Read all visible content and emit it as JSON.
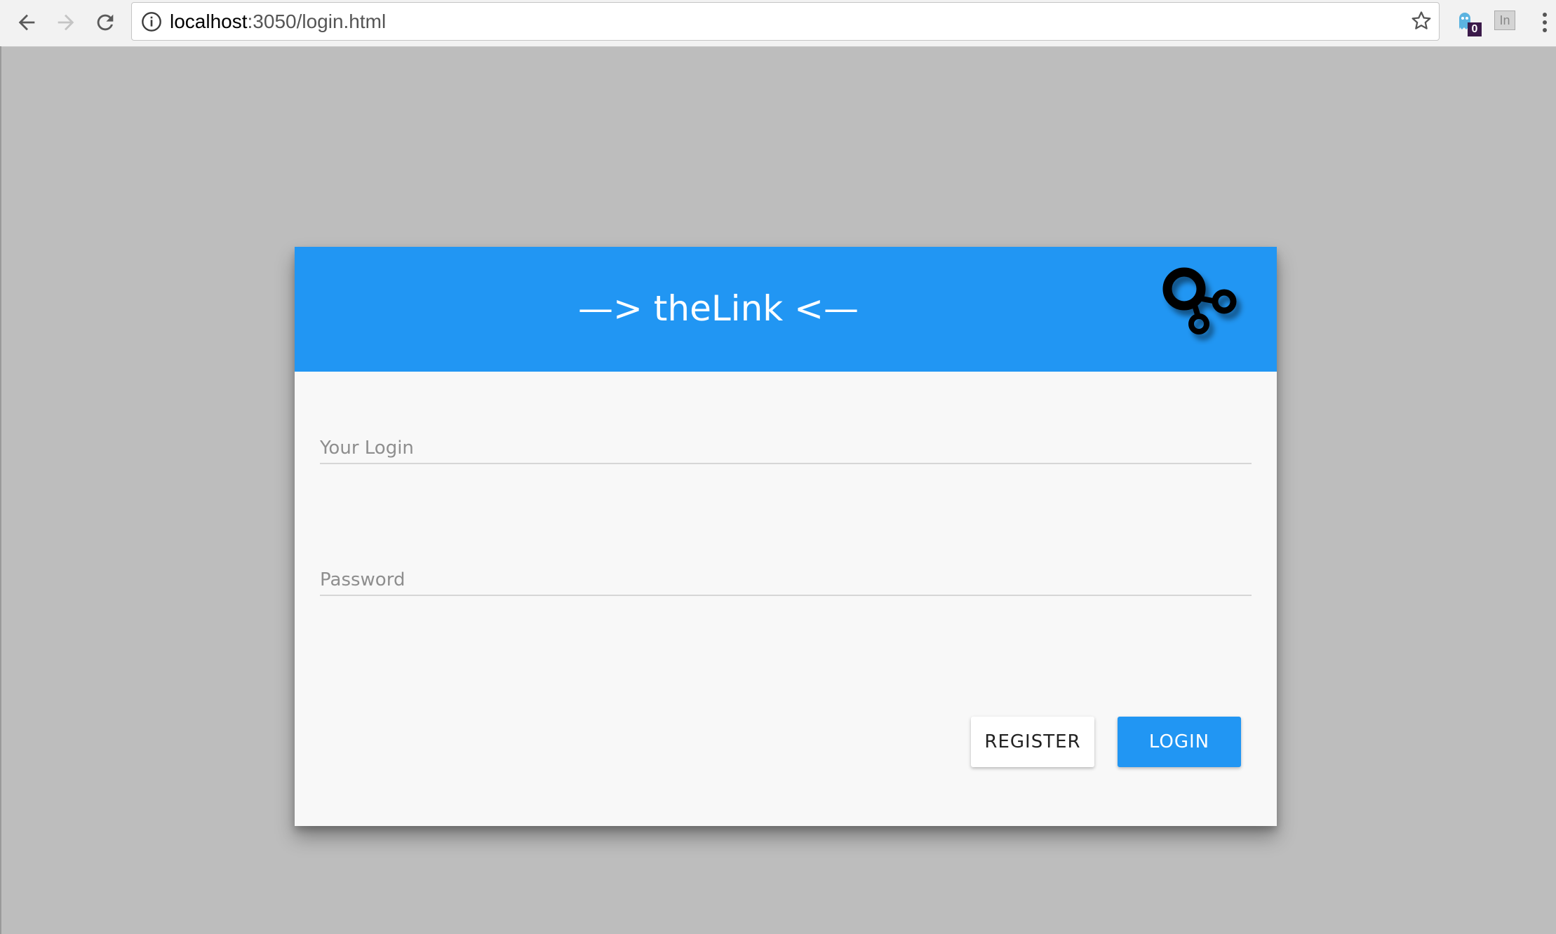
{
  "browser": {
    "url_host": "localhost",
    "url_path": ":3050/login.html",
    "extension_badge": "0",
    "extension_label": "In"
  },
  "icons": {
    "back": "back-arrow-icon",
    "forward": "forward-arrow-icon",
    "reload": "reload-icon",
    "info": "info-icon",
    "bookmark": "star-icon",
    "menu": "menu-dots-icon",
    "logo": "link-logo-icon"
  },
  "colors": {
    "accent": "#2196f3",
    "background": "#bdbdbd",
    "card": "#f8f8f8"
  },
  "card": {
    "title": "—> theLink <—",
    "login_placeholder": "Your Login",
    "password_placeholder": "Password",
    "register_label": "REGISTER",
    "login_label": "LOGIN"
  }
}
